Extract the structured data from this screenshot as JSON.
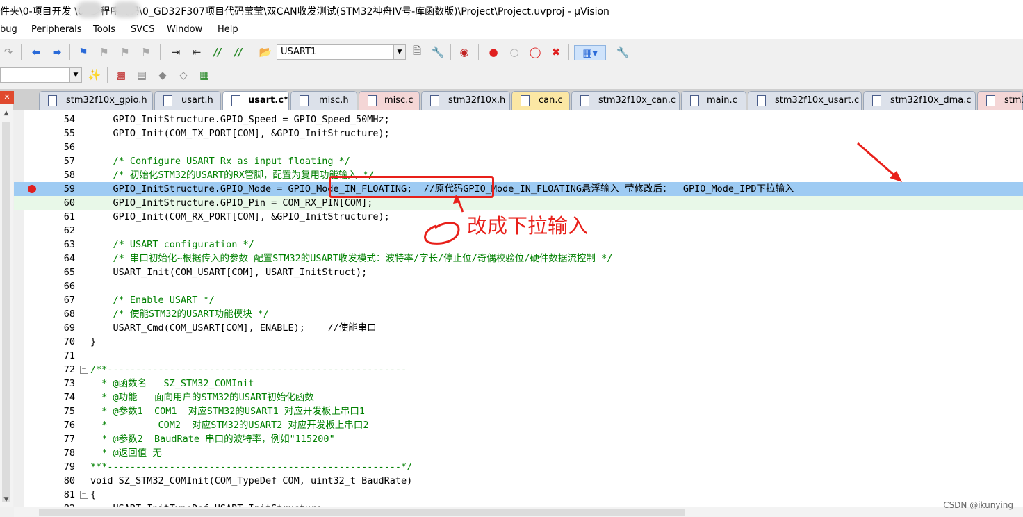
{
  "window": {
    "title": "件夹\\0-项目开发      \\0-      少程序代码\\0_GD32F307项目代码莹莹\\双CAN收发测试(STM32神舟IV号-库函数版)\\Project\\Project.uvproj - µVision"
  },
  "menu": [
    "bug",
    "Peripherals",
    "Tools",
    "SVCS",
    "Window",
    "Help"
  ],
  "toolbar": {
    "target_combo": "USART1"
  },
  "tabs": [
    {
      "label": "stm32f10x_gpio.h",
      "style": "normal"
    },
    {
      "label": "usart.h",
      "style": "normal"
    },
    {
      "label": "usart.c*",
      "style": "active"
    },
    {
      "label": "misc.h",
      "style": "normal"
    },
    {
      "label": "misc.c",
      "style": "pink"
    },
    {
      "label": "stm32f10x.h",
      "style": "normal"
    },
    {
      "label": "can.c",
      "style": "yellow"
    },
    {
      "label": "stm32f10x_can.c",
      "style": "normal"
    },
    {
      "label": "main.c",
      "style": "normal"
    },
    {
      "label": "stm32f10x_usart.c",
      "style": "normal"
    },
    {
      "label": "stm32f10x_dma.c",
      "style": "normal"
    },
    {
      "label": "stm3",
      "style": "pink"
    }
  ],
  "code_lines": [
    {
      "n": "54",
      "text": "    GPIO_InitStructure.GPIO_Speed = GPIO_Speed_50MHz;"
    },
    {
      "n": "55",
      "text": "    GPIO_Init(COM_TX_PORT[COM], &GPIO_InitStructure);"
    },
    {
      "n": "56",
      "text": ""
    },
    {
      "n": "57",
      "text": "    /* Configure USART Rx as input floating */"
    },
    {
      "n": "58",
      "text": "    /* 初始化STM32的USART的RX管脚，配置为复用功能输入 */"
    },
    {
      "n": "59",
      "text": "    GPIO_InitStructure.GPIO_Mode = GPIO_Mode_IN_FLOATING;  //原代码GPIO_Mode_IN_FLOATING悬浮输入 莹修改后：  GPIO_Mode_IPD下拉输入"
    },
    {
      "n": "60",
      "text": "    GPIO_InitStructure.GPIO_Pin = COM_RX_PIN[COM];"
    },
    {
      "n": "61",
      "text": "    GPIO_Init(COM_RX_PORT[COM], &GPIO_InitStructure);"
    },
    {
      "n": "62",
      "text": ""
    },
    {
      "n": "63",
      "text": "    /* USART configuration */"
    },
    {
      "n": "64",
      "text": "    /* 串口初始化~根据传入的参数 配置STM32的USART收发模式：波特率/字长/停止位/奇偶校验位/硬件数据流控制 */"
    },
    {
      "n": "65",
      "text": "    USART_Init(COM_USART[COM], USART_InitStruct);"
    },
    {
      "n": "66",
      "text": ""
    },
    {
      "n": "67",
      "text": "    /* Enable USART */"
    },
    {
      "n": "68",
      "text": "    /* 使能STM32的USART功能模块 */"
    },
    {
      "n": "69",
      "text": "    USART_Cmd(COM_USART[COM], ENABLE);    //使能串口"
    },
    {
      "n": "70",
      "text": "}"
    },
    {
      "n": "71",
      "text": ""
    },
    {
      "n": "72",
      "text": "/**-----------------------------------------------------"
    },
    {
      "n": "73",
      "text": "  * @函数名   SZ_STM32_COMInit"
    },
    {
      "n": "74",
      "text": "  * @功能   面向用户的STM32的USART初始化函数"
    },
    {
      "n": "75",
      "text": "  * @参数1  COM1  对应STM32的USART1 对应开发板上串口1"
    },
    {
      "n": "76",
      "text": "  *         COM2  对应STM32的USART2 对应开发板上串口2"
    },
    {
      "n": "77",
      "text": "  * @参数2  BaudRate 串口的波特率，例如\"115200\""
    },
    {
      "n": "78",
      "text": "  * @返回值 无"
    },
    {
      "n": "79",
      "text": "***----------------------------------------------------*/"
    },
    {
      "n": "80",
      "text": "void SZ_STM32_COMInit(COM_TypeDef COM, uint32_t BaudRate)"
    },
    {
      "n": "81",
      "text": "{"
    },
    {
      "n": "82",
      "text": "    USART_InitTypeDef USART_InitStructure;"
    }
  ],
  "annotation": {
    "text": "改成下拉输入",
    "color": "#e8201a"
  },
  "watermark": "CSDN @ikunying"
}
